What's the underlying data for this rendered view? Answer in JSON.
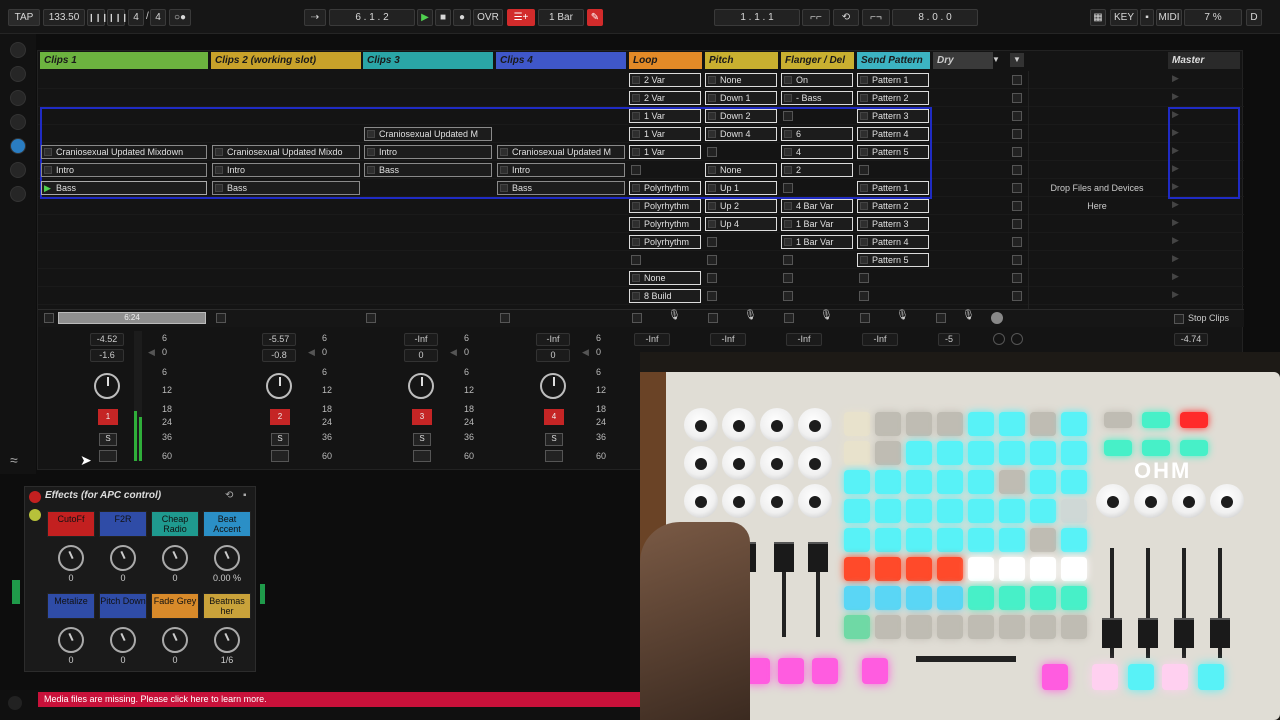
{
  "transport": {
    "tap": "TAP",
    "tempo": "133.50",
    "meter_num": "4",
    "meter_den": "4",
    "position": "6 .  1 .  2",
    "ovr": "OVR",
    "quantize": "1 Bar",
    "loop_start": "1 .  1 .  1",
    "loop_len": "8 .  0 .  0",
    "key": "KEY",
    "midi": "MIDI",
    "cpu": "7 %",
    "d": "D"
  },
  "tracks": [
    {
      "name": "Clips 1",
      "color": "#6cb33f"
    },
    {
      "name": "Clips 2 (working slot)",
      "color": "#c8a22a"
    },
    {
      "name": "Clips 3",
      "color": "#2aa5a6"
    },
    {
      "name": "Clips 4",
      "color": "#3f57c9"
    },
    {
      "name": "Loop",
      "color": "#e38a27"
    },
    {
      "name": "Pitch",
      "color": "#c9b030"
    },
    {
      "name": "Flanger / Del",
      "color": "#c9b030"
    },
    {
      "name": "Send Pattern",
      "color": "#3cb3c2"
    },
    {
      "name": "Dry",
      "color": "#3a3a3a"
    }
  ],
  "master": {
    "name": "Master",
    "stop_clips": "Stop Clips",
    "vol": "-4.74"
  },
  "drop_text": {
    "line1": "Drop Files and Devices",
    "line2": "Here"
  },
  "clips": {
    "c1_r5": "Craniosexual Updated Mixdown",
    "c1_r6": "Intro",
    "c1_r7": "Bass",
    "c2_r5": "Craniosexual Updated Mixdo",
    "c2_r6": "Intro",
    "c2_r7": "Bass",
    "c3_r4": "Craniosexual Updated M",
    "c3_r5": "Intro",
    "c3_r6": "Bass",
    "c4_r5": "Craniosexual Updated M",
    "c4_r6": "Intro",
    "c4_r7": "Bass",
    "loop": [
      "2 Var",
      "2 Var",
      "1 Var",
      "1 Var",
      "1 Var",
      "",
      "Polyrhythm",
      "Polyrhythm",
      "Polyrhythm",
      "Polyrhythm",
      "",
      "None",
      "8 Build"
    ],
    "pitch": [
      "None",
      "Down 1",
      "Down 2",
      "Down 4",
      "",
      "None",
      "Up 1",
      "Up 2",
      "Up 4",
      "",
      "",
      "",
      ""
    ],
    "flanger": [
      "On",
      "- Bass",
      "",
      "6",
      "4",
      "2",
      "",
      "4 Bar Var",
      "1 Bar Var",
      "1 Bar Var",
      "",
      "",
      ""
    ],
    "send": [
      "Pattern 1",
      "Pattern 2",
      "Pattern 3",
      "Pattern 4",
      "Pattern 5",
      "",
      "Pattern 1",
      "Pattern 2",
      "Pattern 3",
      "Pattern 4",
      "Pattern 5",
      "",
      ""
    ]
  },
  "mixer": {
    "progress": "6:24",
    "ch1": {
      "a": "-4.52",
      "b": "-1.6",
      "num": "1",
      "s": "S"
    },
    "ch2": {
      "a": "-5.57",
      "b": "-0.8",
      "num": "2",
      "s": "S"
    },
    "ch3": {
      "a": "-Inf",
      "b": "0",
      "num": "3",
      "s": "S"
    },
    "ch4": {
      "a": "-Inf",
      "b": "0",
      "num": "4",
      "s": "S"
    },
    "ret": [
      "-Inf",
      "-Inf",
      "-Inf",
      "-Inf",
      "-5"
    ],
    "scale": [
      "6",
      "0",
      "6",
      "12",
      "18",
      "24",
      "36",
      "60"
    ]
  },
  "device": {
    "title": "Effects (for APC control)",
    "macros": [
      {
        "label": "CutoFf",
        "value": "0",
        "color": "#c32020"
      },
      {
        "label": "F2R",
        "value": "0",
        "color": "#2f4ca7"
      },
      {
        "label": "Cheap Radio",
        "value": "0",
        "color": "#1f9a8f"
      },
      {
        "label": "Beat Accent",
        "value": "0.00 %",
        "color": "#2b8fc6"
      },
      {
        "label": "Metalize",
        "value": "0",
        "color": "#2f4ca7"
      },
      {
        "label": "Pitch Down",
        "value": "0",
        "color": "#2f4ca7"
      },
      {
        "label": "Fade Grey",
        "value": "0",
        "color": "#d88a2a"
      },
      {
        "label": "Beatmas her",
        "value": "1/6",
        "color": "#c9a23a"
      }
    ]
  },
  "status": {
    "message": "Media files are missing. Please click here to learn more."
  },
  "controller": {
    "brand": "OHM"
  }
}
